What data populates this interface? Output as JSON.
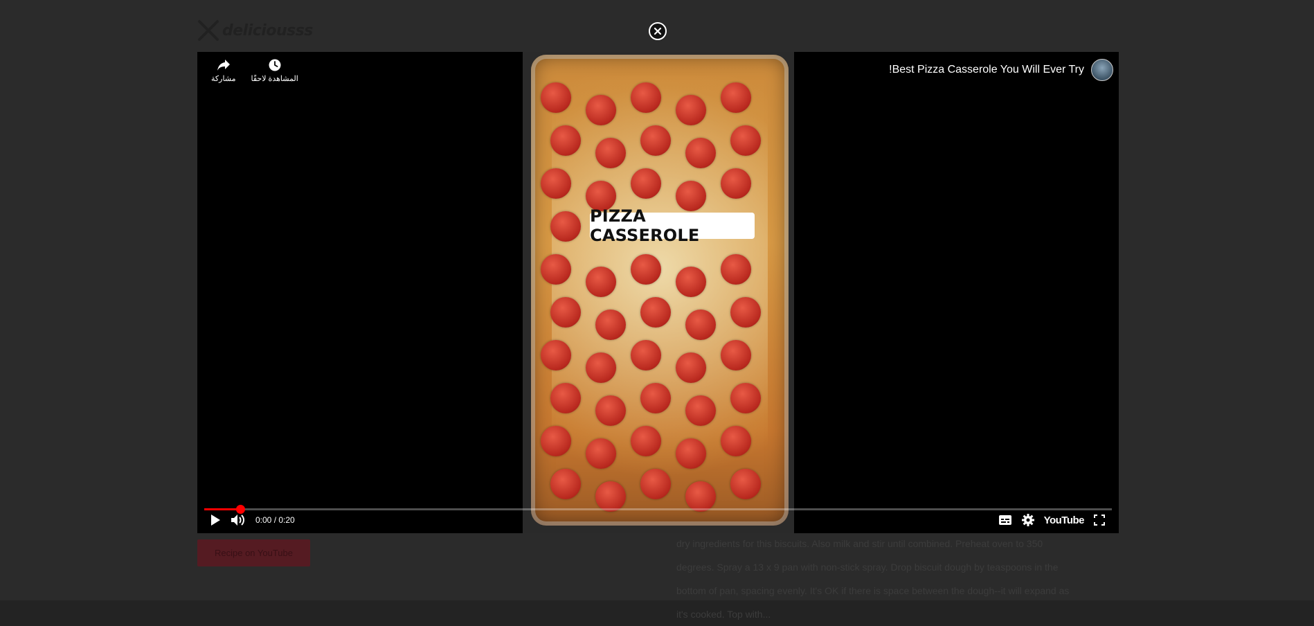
{
  "page": {
    "logo_text": "deliciousss",
    "recipe_button_label": "Recipe on YouTube",
    "recipe_lines": [
      "dry ingredients for this biscuits. Also milk and stir until combined. Preheat oven to 350",
      "degrees. Spray a 13 x 9 pan with non-stick spray. Drop biscuit dough by teaspoons in the",
      "bottom of pan, spacing evenly. It's OK if there is space between the dough--it will expand as",
      "it's cooked. Top with..."
    ]
  },
  "player": {
    "title": "Best Pizza Casserole You Will Ever Try!",
    "overlay_text": "PIZZA CASSEROLE",
    "actions": {
      "share": "مشاركة",
      "watch_later": "المشاهدة لاحقًا"
    },
    "time": "0:00 / 0:20",
    "progress_fraction": 0.04,
    "brand": "YouTube"
  },
  "colors": {
    "accent": "#ff0000",
    "overlay_background": "#000000"
  },
  "icons": {
    "close": "close-icon",
    "share": "share-icon",
    "watch_later": "clock-icon",
    "play": "play-icon",
    "volume": "volume-icon",
    "subtitles": "subtitles-icon",
    "settings": "gear-icon",
    "fullscreen": "fullscreen-icon"
  }
}
